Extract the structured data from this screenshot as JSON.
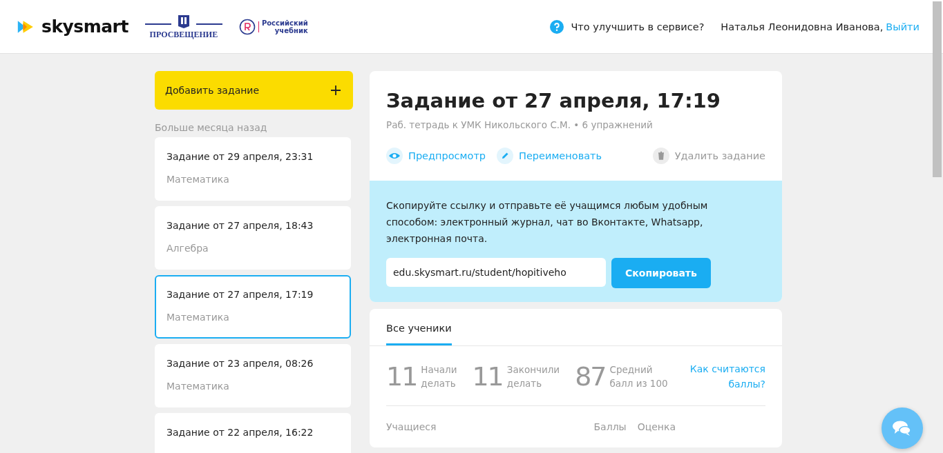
{
  "header": {
    "brand": "skysmart",
    "partner_1": "ПРОСВЕЩЕНИЕ",
    "partner_2": [
      "Российский",
      "учебник"
    ],
    "feedback": "Что улучшить в сервисе?",
    "user": "Наталья Леонидовна Иванова,",
    "logout": "Выйти"
  },
  "sidebar": {
    "add_button": "Добавить задание",
    "group_label": "Больше месяца назад",
    "items": [
      {
        "title": "Задание от 29 апреля, 23:31",
        "subject": "Математика",
        "selected": false
      },
      {
        "title": "Задание от 27 апреля, 18:43",
        "subject": "Алгебра",
        "selected": false
      },
      {
        "title": "Задание от 27 апреля, 17:19",
        "subject": "Математика",
        "selected": true
      },
      {
        "title": "Задание от 23 апреля, 08:26",
        "subject": "Математика",
        "selected": false
      },
      {
        "title": "Задание от 22 апреля, 16:22",
        "selected": false
      }
    ]
  },
  "task": {
    "title": "Задание от 27 апреля, 17:19",
    "meta": "Раб. тетрадь к УМК Никольского С.М. • 6 упражнений",
    "actions": [
      {
        "kind": "preview",
        "label": "Предпросмотр"
      },
      {
        "kind": "rename",
        "label": "Переименовать"
      },
      {
        "kind": "delete",
        "label": "Удалить задание"
      }
    ]
  },
  "share": {
    "text": "Скопируйте ссылку и отправьте её учащимся любым удобным способом: электронный журнал, чат во Вконтакте, Whatsapp, электронная почта.",
    "link": "edu.skysmart.ru/student/hopitiveho",
    "copy_button": "Скопировать"
  },
  "results": {
    "tabs": [
      {
        "label": "Все ученики",
        "selected": true
      }
    ],
    "stats": [
      {
        "value": "11",
        "label": [
          "Начали",
          "делать"
        ]
      },
      {
        "value": "11",
        "label": [
          "Закончили",
          "делать"
        ]
      },
      {
        "value": "87",
        "label": [
          "Средний",
          "балл из 100"
        ]
      }
    ],
    "help_link": [
      "Как считаются",
      "баллы?"
    ],
    "columns": [
      "Учащиеся",
      "Баллы",
      "Оценка"
    ]
  }
}
